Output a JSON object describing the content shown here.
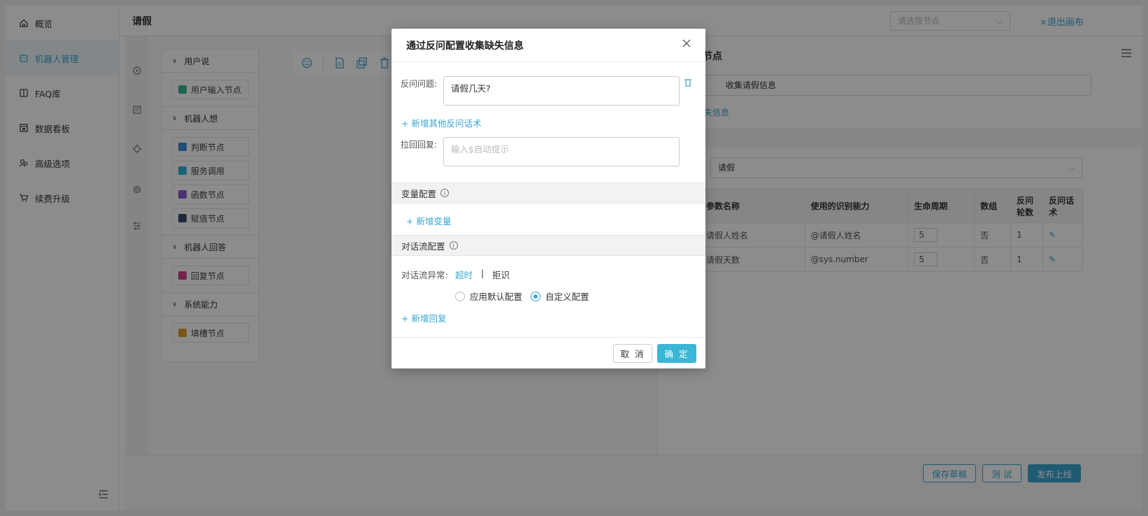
{
  "nav": {
    "items": [
      {
        "label": "概览",
        "icon": "home-icon"
      },
      {
        "label": "机器人管理",
        "icon": "robot-icon",
        "active": true
      },
      {
        "label": "FAQ库",
        "icon": "book-icon"
      },
      {
        "label": "数据看板",
        "icon": "dashboard-icon"
      },
      {
        "label": "高级选项",
        "icon": "users-icon"
      },
      {
        "label": "续费升级",
        "icon": "cart-icon"
      }
    ]
  },
  "header": {
    "title": "请假",
    "node_select_placeholder": "请选择节点",
    "exit_label": "×退出画布"
  },
  "panel": {
    "sections": [
      {
        "title": "用户说",
        "nodes": [
          {
            "label": "用户输入节点",
            "color": "#3bb89a"
          }
        ]
      },
      {
        "title": "机器人想",
        "nodes": [
          {
            "label": "判断节点",
            "color": "#3a8fd6"
          },
          {
            "label": "服务调用",
            "color": "#33b3d6"
          },
          {
            "label": "函数节点",
            "color": "#8a5bd6"
          },
          {
            "label": "赋值节点",
            "color": "#3a4b6e"
          }
        ]
      },
      {
        "title": "机器人回答",
        "nodes": [
          {
            "label": "回复节点",
            "color": "#d6428a"
          }
        ]
      },
      {
        "title": "系统能力",
        "nodes": [
          {
            "label": "填槽节点",
            "color": "#e0a12a"
          }
        ]
      }
    ]
  },
  "right_panel": {
    "title": "节点",
    "name_value": "收集请假信息",
    "link_label": "失信息",
    "intent_value": "请假",
    "table": {
      "headers": [
        "参数名称",
        "使用的识别能力",
        "生命周期",
        "数组",
        "反问轮数",
        "反问话术"
      ],
      "rows": [
        {
          "name": "请假人姓名",
          "ability": "@请假人姓名",
          "life": "5",
          "array": "否",
          "rounds": "1"
        },
        {
          "name": "请假天数",
          "ability": "@sys.number",
          "life": "5",
          "array": "否",
          "rounds": "1"
        }
      ]
    }
  },
  "footer": {
    "save_label": "保存草稿",
    "test_label": "测 试",
    "publish_label": "发布上线"
  },
  "modal": {
    "title": "通过反问配置收集缺失信息",
    "question_label": "反问问题:",
    "question_value": "请假几天?",
    "add_question_link": "+ 新增其他反问话术",
    "pullback_label": "拉回回复:",
    "pullback_placeholder": "输入$自动提示",
    "var_section": "变量配置",
    "add_var_link": "+ 新增变量",
    "flow_section": "对话流配置",
    "flow_exception_label": "对话流异常:",
    "tab_timeout": "超时",
    "tab_sep": "|",
    "tab_reject": "拒识",
    "radio_default": "应用默认配置",
    "radio_custom": "自定义配置",
    "add_reply_link": "+ 新增回复",
    "cancel_label": "取 消",
    "ok_label": "确 定"
  }
}
